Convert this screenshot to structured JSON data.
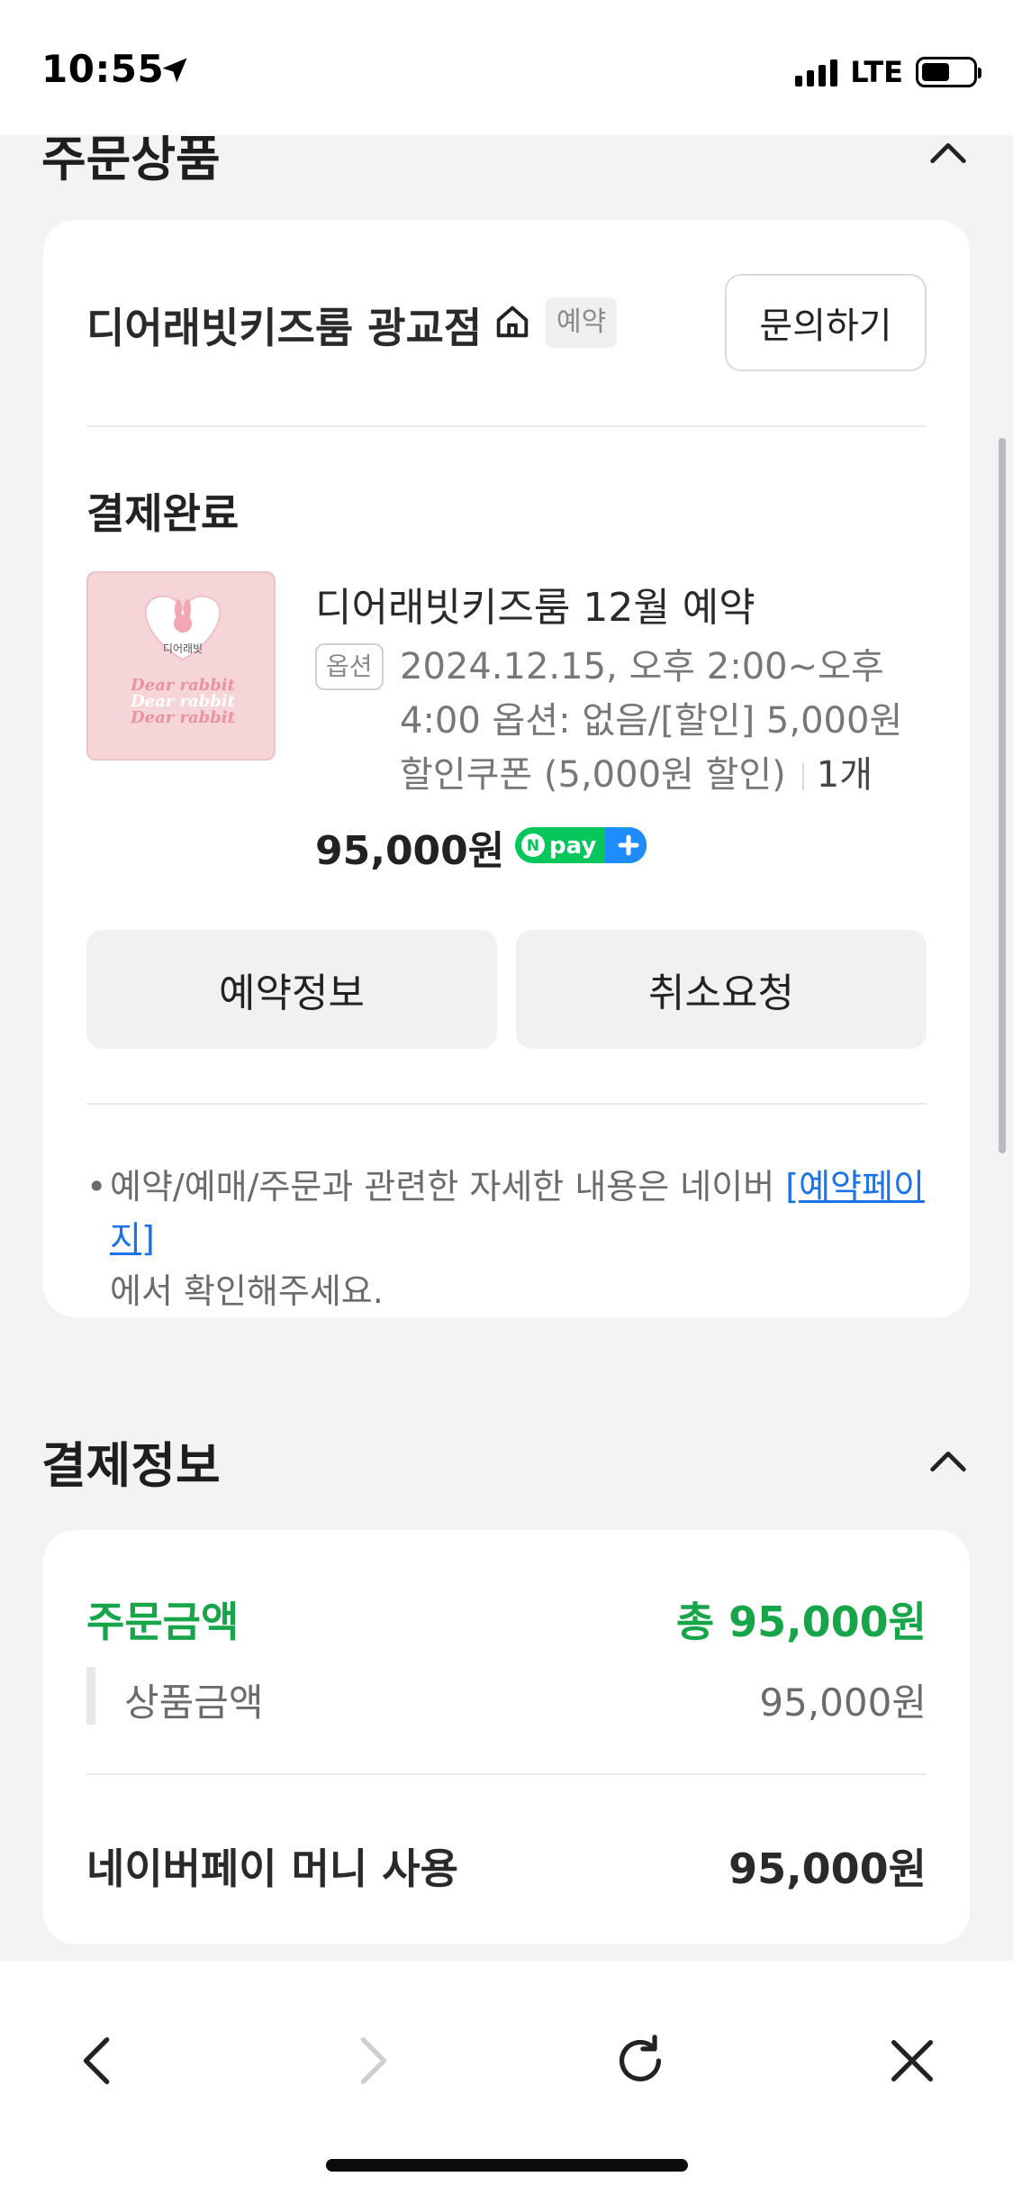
{
  "status_bar": {
    "time": "10:55",
    "network": "LTE"
  },
  "order_section": {
    "title": "주문상품",
    "store": {
      "name": "디어래빗키즈룸 광교점",
      "tag": "예약",
      "inquiry_label": "문의하기"
    },
    "status": "결제완료",
    "product": {
      "thumb_text": "디어래빗",
      "thumb_lines": [
        "Dear rabbit",
        "Dear rabbit",
        "Dear rabbit"
      ],
      "name": "디어래빗키즈룸 12월 예약",
      "option_tag": "옵션",
      "option_text": "2024.12.15, 오후 2:00~오후 4:00 옵션: 없음/[할인] 5,000원 할인쿠폰 (5,000원 할인)",
      "quantity": "1개",
      "price": "95,000원",
      "npay_text": "pay"
    },
    "buttons": {
      "reservation_info": "예약정보",
      "cancel_request": "취소요청"
    },
    "notice": {
      "prefix": "예약/예매/주문과 관련한 자세한 내용은 네이버 ",
      "link": "[예약페이지]",
      "suffix": "에서 확인해주세요."
    }
  },
  "payment_section": {
    "title": "결제정보",
    "order_amount_label": "주문금액",
    "order_amount_total": "총 95,000원",
    "product_amount_label": "상품금액",
    "product_amount_value": "95,000원",
    "npay_money_label": "네이버페이 머니 사용",
    "npay_money_value": "95,000원"
  },
  "colors": {
    "accent_green": "#17a54a",
    "link_blue": "#1a73e8",
    "npay_green": "#03c75a",
    "npay_blue": "#1e8cff"
  },
  "toolbar_icons": [
    "back-icon",
    "forward-icon",
    "reload-icon",
    "close-icon"
  ]
}
